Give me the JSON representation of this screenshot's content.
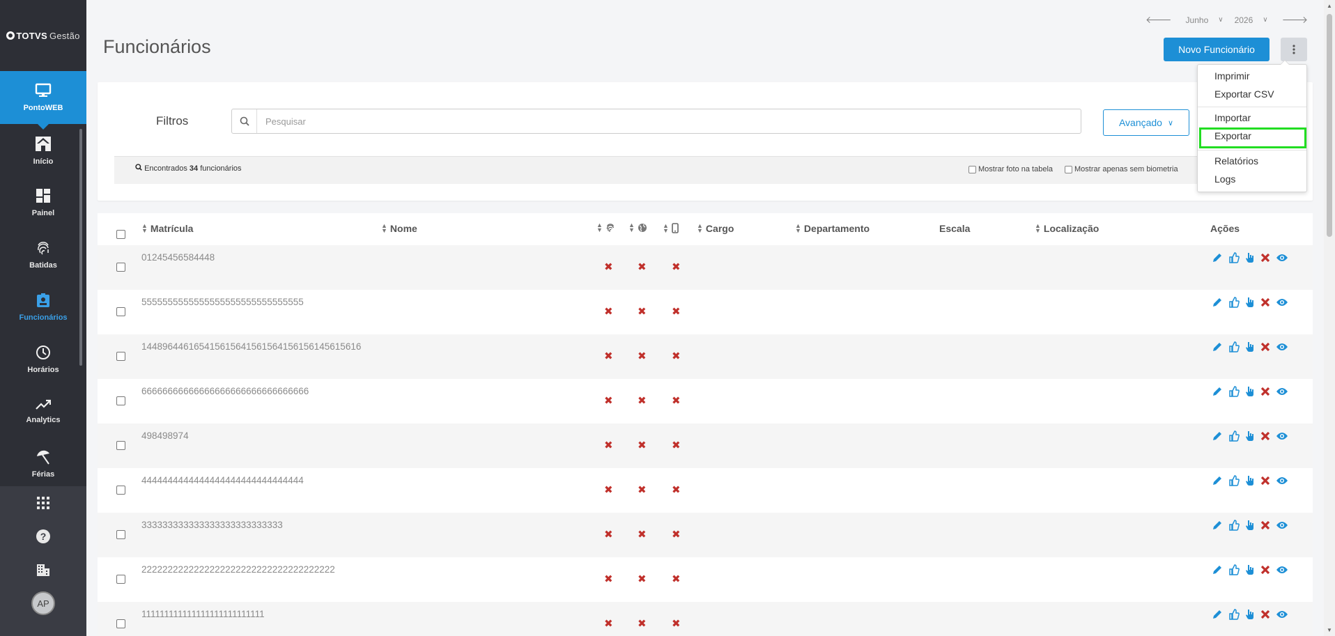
{
  "sidebar": {
    "logo_brand": "TOTVS",
    "logo_product": "Gestão",
    "module_label": "PontoWEB",
    "items": [
      {
        "label": "Início",
        "icon": "home-icon"
      },
      {
        "label": "Painel",
        "icon": "dashboard-icon"
      },
      {
        "label": "Batidas",
        "icon": "fingerprint-icon"
      },
      {
        "label": "Funcionários",
        "icon": "badge-icon",
        "active": true
      },
      {
        "label": "Horários",
        "icon": "clock-icon"
      },
      {
        "label": "Analytics",
        "icon": "trending-icon"
      },
      {
        "label": "Férias",
        "icon": "beach-umbrella-icon"
      }
    ],
    "avatar_initials": "AP"
  },
  "header": {
    "title": "Funcionários",
    "month": "Junho",
    "year": "2026",
    "new_button": "Novo Funcionário"
  },
  "filters": {
    "label": "Filtros",
    "search_placeholder": "Pesquisar",
    "advanced_button": "Avançado",
    "found_prefix": "Encontrados",
    "found_count": "34",
    "found_suffix": "funcionários",
    "show_photo": "Mostrar foto na tabela",
    "show_no_biometry": "Mostrar apenas sem biometria"
  },
  "table": {
    "columns": {
      "matricula": "Matrícula",
      "nome": "Nome",
      "cargo": "Cargo",
      "departamento": "Departamento",
      "escala": "Escala",
      "localizacao": "Localização",
      "acoes": "Ações"
    },
    "rows": [
      {
        "matricula": "01245456584448"
      },
      {
        "matricula": "5555555555555555555555555555555"
      },
      {
        "matricula": "144896446165415615641561564156156145615616"
      },
      {
        "matricula": "66666666666666666666666666666666"
      },
      {
        "matricula": "498498974"
      },
      {
        "matricula": "4444444444444444444444444444444"
      },
      {
        "matricula": "333333333333333333333333333"
      },
      {
        "matricula": "2222222222222222222222222222222222222"
      },
      {
        "matricula": "111111111111111111111111111"
      }
    ],
    "status_mark": "✖"
  },
  "menu": {
    "items": [
      "Imprimir",
      "Exportar CSV",
      "Importar",
      "Exportar",
      "Relatórios",
      "Logs"
    ],
    "highlighted": "Exportar"
  },
  "colors": {
    "sidebar_bg": "#2d2f36",
    "accent": "#1d8fd6",
    "danger": "#c0302b",
    "highlight": "#22dd22"
  }
}
